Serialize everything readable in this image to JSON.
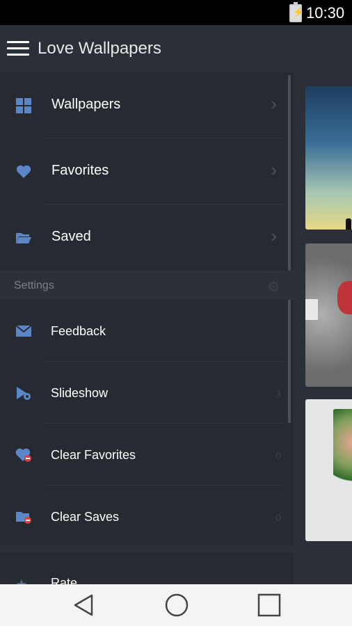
{
  "status_bar": {
    "time": "10:30"
  },
  "app_bar": {
    "title": "Love Wallpapers"
  },
  "drawer": {
    "nav_items": [
      {
        "label": "Wallpapers",
        "icon": "grid-icon"
      },
      {
        "label": "Favorites",
        "icon": "heart-icon"
      },
      {
        "label": "Saved",
        "icon": "folder-open-icon"
      }
    ],
    "settings_header": "Settings",
    "settings_items": [
      {
        "label": "Feedback",
        "icon": "envelope-icon",
        "count": ""
      },
      {
        "label": "Slideshow",
        "icon": "slideshow-icon",
        "count": "3"
      },
      {
        "label": "Clear Favorites",
        "icon": "heart-remove-icon",
        "count": "0"
      },
      {
        "label": "Clear Saves",
        "icon": "folder-remove-icon",
        "count": "0"
      }
    ],
    "rate_item": {
      "label": "Rate",
      "icon": "star-icon"
    }
  },
  "colors": {
    "accent_icon": "#5b86c8",
    "drawer_bg": "#262a31",
    "app_bar_bg": "#2b3038",
    "remove_badge": "#d9423c"
  }
}
